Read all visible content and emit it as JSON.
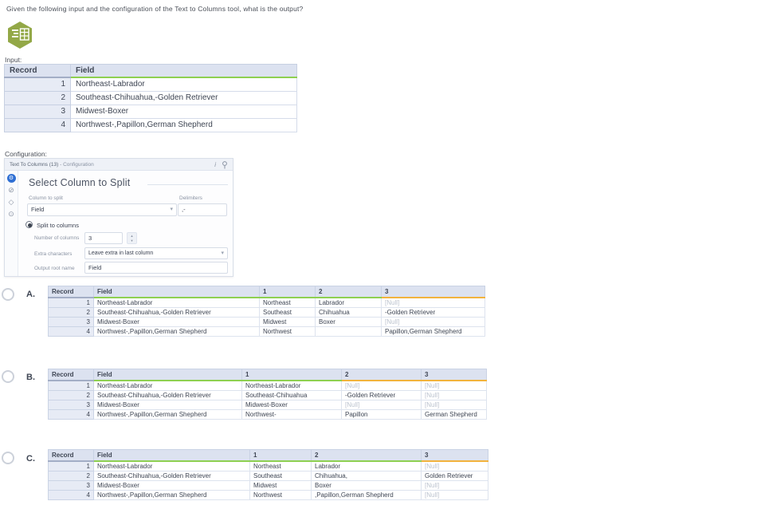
{
  "question": "Given the following input and the configuration of the Text to Columns tool, what is the output?",
  "icons": {
    "gear": "⚙",
    "cancel": "⊘",
    "tag": "◇",
    "clock": "⊙",
    "info": "i",
    "chevron": "▾",
    "up": "▲",
    "down": "▼"
  },
  "input_section": {
    "label": "Input:",
    "headers": [
      "Record",
      "Field"
    ],
    "rows": [
      [
        "1",
        "Northeast-Labrador"
      ],
      [
        "2",
        "Southeast-Chihuahua,-Golden Retriever"
      ],
      [
        "3",
        "Midwest-Boxer"
      ],
      [
        "4",
        "Northwest-,Papillon,German Shepherd"
      ]
    ]
  },
  "config_section": {
    "label": "Configuration:",
    "window_title": "Text To Columns (13)",
    "window_title_suffix": " - Configuration",
    "heading": "Select Column to Split",
    "column_to_split_label": "Column to split",
    "column_to_split_value": "Field",
    "delimiters_label": "Delimiters",
    "delimiters_value": ",-",
    "split_radio_label": "Split to columns",
    "number_of_columns_label": "Number of columns",
    "number_of_columns_value": "3",
    "extra_characters_label": "Extra characters",
    "extra_characters_value": "Leave extra in last column",
    "output_root_name_label": "Output root name",
    "output_root_name_value": "Field"
  },
  "options": [
    {
      "letter": "A.",
      "headers": [
        "Record",
        "Field",
        "1",
        "2",
        "3"
      ],
      "rows": [
        [
          "1",
          "Northeast-Labrador",
          "Northeast",
          "Labrador",
          "[Null]"
        ],
        [
          "2",
          "Southeast-Chihuahua,-Golden Retriever",
          "Southeast",
          "Chihuahua",
          "-Golden Retriever"
        ],
        [
          "3",
          "Midwest-Boxer",
          "Midwest",
          "Boxer",
          "[Null]"
        ],
        [
          "4",
          "Northwest-,Papillon,German Shepherd",
          "Northwest",
          "",
          "Papillon,German Shepherd"
        ]
      ]
    },
    {
      "letter": "B.",
      "headers": [
        "Record",
        "Field",
        "1",
        "2",
        "3"
      ],
      "rows": [
        [
          "1",
          "Northeast-Labrador",
          "Northeast-Labrador",
          "[Null]",
          "[Null]"
        ],
        [
          "2",
          "Southeast-Chihuahua,-Golden Retriever",
          "Southeast-Chihuahua",
          "-Golden Retriever",
          "[Null]"
        ],
        [
          "3",
          "Midwest-Boxer",
          "Midwest-Boxer",
          "[Null]",
          "[Null]"
        ],
        [
          "4",
          "Northwest-,Papillon,German Shepherd",
          "Northwest-",
          "Papillon",
          "German Shepherd"
        ]
      ]
    },
    {
      "letter": "C.",
      "headers": [
        "Record",
        "Field",
        "1",
        "2",
        "3"
      ],
      "rows": [
        [
          "1",
          "Northeast-Labrador",
          "Northeast",
          "Labrador",
          "[Null]"
        ],
        [
          "2",
          "Southeast-Chihuahua,-Golden Retriever",
          "Southeast",
          "Chihuahua,",
          "Golden Retriever"
        ],
        [
          "3",
          "Midwest-Boxer",
          "Midwest",
          "Boxer",
          "[Null]"
        ],
        [
          "4",
          "Northwest-,Papillon,German Shepherd",
          "Northwest",
          ",Papillon,German Shepherd",
          "[Null]"
        ]
      ]
    }
  ],
  "colors": {
    "accent_green": "#8ed051",
    "accent_orange": "#f2b33d",
    "header_bg": "#dce2f0",
    "tool_green": "#93a847",
    "selected_icon_blue": "#2f6fd3"
  }
}
